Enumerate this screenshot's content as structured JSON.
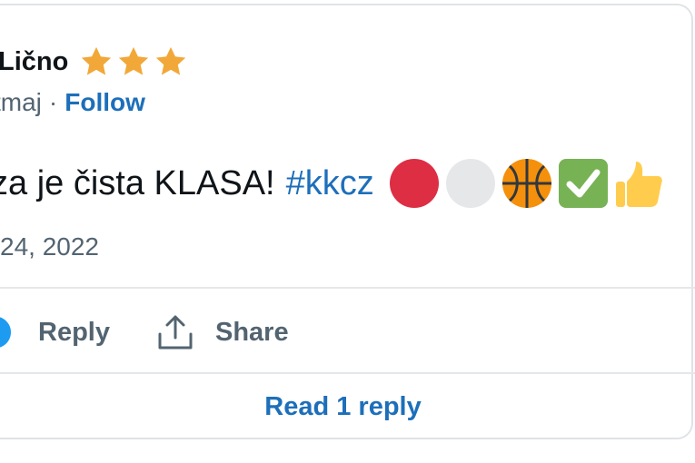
{
  "tweet": {
    "author_name": "Lično",
    "stars": [
      "star-icon",
      "star-icon",
      "star-icon"
    ],
    "star_color": "#f2a838",
    "handle": "tmaj",
    "separator": "·",
    "follow_label": "Follow",
    "text": "za je čista KLASA!",
    "hashtag": "#kkcz",
    "emojis": [
      "red-circle-icon",
      "white-circle-icon",
      "basketball-icon",
      "check-mark-button-icon",
      "thumbs-up-icon"
    ],
    "date": "24, 2022"
  },
  "actions": {
    "reply_label": "Reply",
    "share_label": "Share"
  },
  "footer": {
    "read_reply_label": "Read 1 reply"
  },
  "colors": {
    "link": "#1d6fba",
    "text": "#0f1419",
    "muted": "#536471",
    "border": "#dfe3e6"
  }
}
